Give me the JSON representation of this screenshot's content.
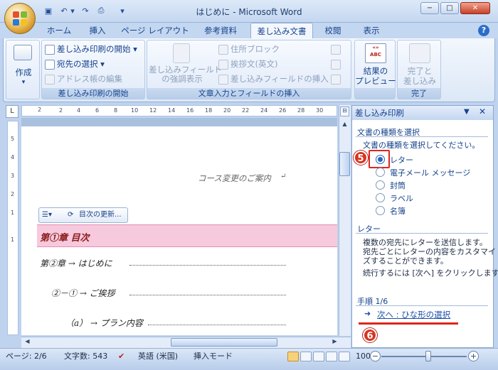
{
  "window": {
    "title": "はじめに - Microsoft Word",
    "minimize": "−",
    "maximize": "□",
    "close": "✕"
  },
  "ribbon_tabs": [
    "ホーム",
    "挿入",
    "ページ レイアウト",
    "参考資料",
    "差し込み文書",
    "校閲",
    "表示"
  ],
  "active_tab": "差し込み文書",
  "ribbon": {
    "create": {
      "label": "作成",
      "group": ""
    },
    "start_group": {
      "items": [
        "差し込み印刷の開始",
        "宛先の選択",
        "アドレス帳の編集"
      ],
      "label": "差し込み印刷の開始"
    },
    "fields_group": {
      "highlight": "差し込みフィールドの強調表示",
      "highlight_line1": "差し込みフィールド",
      "highlight_line2": "の強調表示",
      "items": [
        "住所ブロック",
        "挨拶文(英文)",
        "差し込みフィールドの挿入"
      ],
      "label": "文章入力とフィールドの挿入"
    },
    "preview_group": {
      "abc": "ABC",
      "preview_line1": "結果の",
      "preview_line2": "プレビュー",
      "label": ""
    },
    "finish_group": {
      "finish_line1": "完了と",
      "finish_line2": "差し込み",
      "label": "完了"
    }
  },
  "ruler": {
    "corner": "L",
    "h_ticks": [
      "2",
      "2",
      "4",
      "6",
      "8",
      "10",
      "12",
      "14",
      "16",
      "18",
      "20",
      "22",
      "24",
      "26",
      "28",
      "30"
    ],
    "v_ticks": [
      "5",
      "4",
      "3",
      "2",
      "1",
      "1"
    ]
  },
  "document": {
    "course_notice": "コース変更のご案内",
    "minibar_label": "目次の更新...",
    "heading": "第①章 目次",
    "toc": [
      {
        "text": "第②章 → はじめに"
      },
      {
        "text": "②－① → ご挨拶"
      },
      {
        "text": "（a） → プラン内容"
      }
    ]
  },
  "task_pane": {
    "title": "差し込み印刷",
    "section1_title": "文書の種類を選択",
    "section1_prompt": "文書の種類を選択してください。",
    "options": [
      {
        "label": "レター",
        "selected": true
      },
      {
        "label": "電子メール メッセージ",
        "selected": false
      },
      {
        "label": "封筒",
        "selected": false
      },
      {
        "label": "ラベル",
        "selected": false
      },
      {
        "label": "名簿",
        "selected": false
      }
    ],
    "section2_title": "レター",
    "desc1": "複数の宛先にレターを送信します。",
    "desc2": "宛先ごとにレターの内容をカスタマイ",
    "desc3": "ズすることができます。",
    "desc4": "続行するには [次へ] をクリックします。",
    "step": "手順 1/6",
    "next_link": "次へ : ひな形の選択",
    "badge5": "5",
    "badge6": "6"
  },
  "status": {
    "page": "ページ: 2/6",
    "words": "文字数: 543",
    "language": "英語 (米国)",
    "mode": "挿入モード",
    "zoom": "100%",
    "zoom_level": 1.0
  },
  "colors": {
    "accent": "#15428b",
    "highlight_row": "#f7c9dc",
    "badge": "#d7341f"
  }
}
